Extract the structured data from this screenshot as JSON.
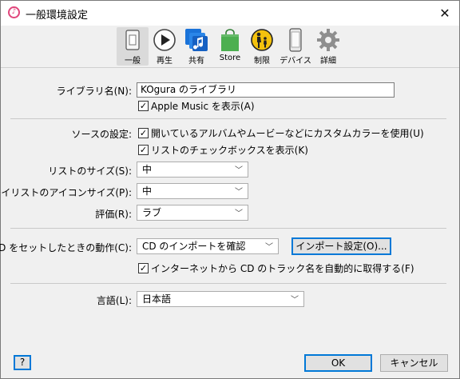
{
  "window": {
    "title": "一般環境設定",
    "close_glyph": "✕"
  },
  "toolbar": {
    "items": [
      {
        "label": "一般",
        "icon": "general-icon",
        "active": true
      },
      {
        "label": "再生",
        "icon": "play-icon"
      },
      {
        "label": "共有",
        "icon": "music-share-icon"
      },
      {
        "label": "Store",
        "icon": "store-bag-icon"
      },
      {
        "label": "制限",
        "icon": "parental-icon"
      },
      {
        "label": "デバイス",
        "icon": "device-icon"
      },
      {
        "label": "詳細",
        "icon": "gear-icon"
      }
    ]
  },
  "library": {
    "name_label": "ライブラリ名(N):",
    "name_value": "KOgura のライブラリ",
    "show_apple_music": {
      "label": "Apple Music を表示(A)",
      "checked": true
    }
  },
  "source": {
    "label": "ソースの設定:",
    "custom_colors": {
      "label": "開いているアルバムやムービーなどにカスタムカラーを使用(U)",
      "checked": true
    },
    "list_checkboxes": {
      "label": "リストのチェックボックスを表示(K)",
      "checked": true
    }
  },
  "list_size": {
    "label": "リストのサイズ(S):",
    "value": "中"
  },
  "playlist_icon_size": {
    "label": "プレイリストのアイコンサイズ(P):",
    "value": "中"
  },
  "rating": {
    "label": "評価(R):",
    "value": "ラブ"
  },
  "cd": {
    "label": "CD をセットしたときの動作(C):",
    "value": "CD のインポートを確認",
    "import_settings_button": "インポート設定(O)...",
    "get_track_names": {
      "label": "インターネットから CD のトラック名を自動的に取得する(F)",
      "checked": true
    }
  },
  "language": {
    "label": "言語(L):",
    "value": "日本語"
  },
  "footer": {
    "help": "?",
    "ok": "OK",
    "cancel": "キャンセル"
  },
  "colors": {
    "accent": "#0078d7",
    "itunes_pink": "#e0457b",
    "store_green": "#4caf50",
    "share_blue": "#1a73d9"
  }
}
